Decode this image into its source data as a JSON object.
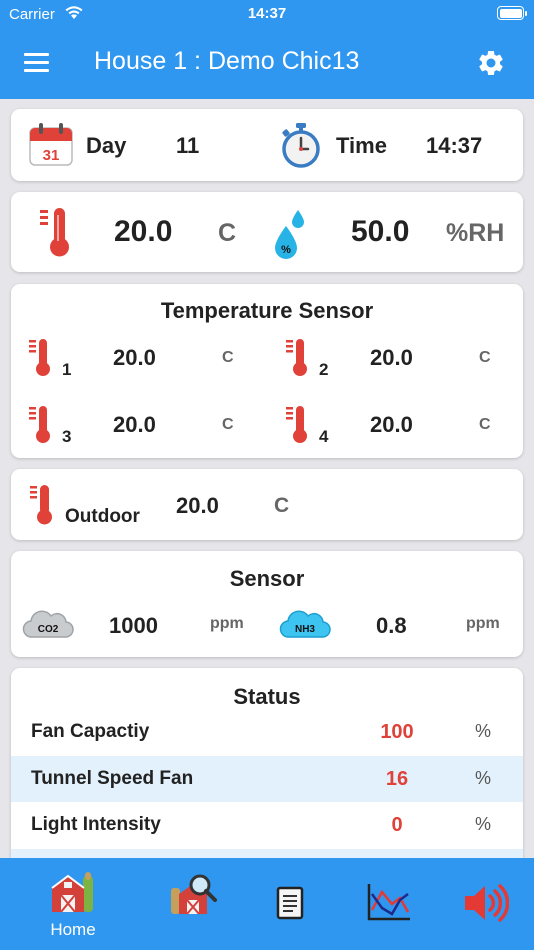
{
  "status_bar": {
    "carrier": "Carrier",
    "time": "14:37"
  },
  "header": {
    "title": "House 1 : Demo Chic13"
  },
  "day_time": {
    "calendar_day": "31",
    "day_label": "Day",
    "day_value": "11",
    "time_label": "Time",
    "time_value": "14:37"
  },
  "climate": {
    "temperature": "20.0",
    "temperature_unit": "C",
    "humidity": "50.0",
    "humidity_unit": "%RH",
    "humidity_icon_text": "%"
  },
  "temperature_sensor": {
    "title": "Temperature Sensor",
    "sensors": [
      {
        "index": "1",
        "value": "20.0",
        "unit": "C"
      },
      {
        "index": "2",
        "value": "20.0",
        "unit": "C"
      },
      {
        "index": "3",
        "value": "20.0",
        "unit": "C"
      },
      {
        "index": "4",
        "value": "20.0",
        "unit": "C"
      }
    ]
  },
  "outdoor": {
    "label": "Outdoor",
    "value": "20.0",
    "unit": "C"
  },
  "sensor": {
    "title": "Sensor",
    "co2": {
      "icon_text": "CO2",
      "value": "1000",
      "unit": "ppm"
    },
    "nh3": {
      "icon_text": "NH3",
      "value": "0.8",
      "unit": "ppm"
    }
  },
  "status": {
    "title": "Status",
    "rows": [
      {
        "label": "Fan Capactiy",
        "value": "100",
        "unit": "%"
      },
      {
        "label": "Tunnel Speed Fan",
        "value": "16",
        "unit": "%"
      },
      {
        "label": "Light Intensity",
        "value": "0",
        "unit": "%"
      }
    ]
  },
  "tabs": [
    {
      "label": "Home",
      "icon": "barn-icon"
    },
    {
      "label": "",
      "icon": "barn-search-icon"
    },
    {
      "label": "",
      "icon": "document-icon"
    },
    {
      "label": "",
      "icon": "line-chart-icon"
    },
    {
      "label": "",
      "icon": "speaker-icon"
    }
  ],
  "colors": {
    "header": "#2f97ef",
    "accent_value": "#e0423a",
    "alt_row": "#e3f1fc"
  }
}
